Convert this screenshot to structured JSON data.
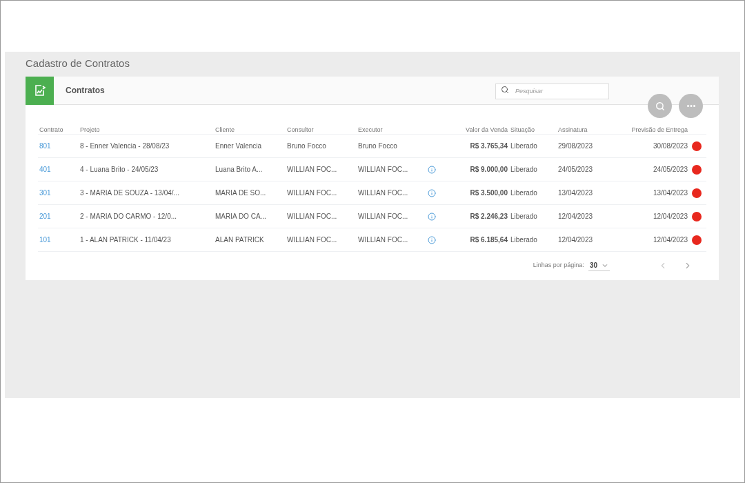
{
  "page_title": "Cadastro de Contratos",
  "card": {
    "title": "Contratos",
    "search": {
      "placeholder": "Pesquisar"
    }
  },
  "table": {
    "columns": [
      "Contrato",
      "Projeto",
      "Cliente",
      "Consultor",
      "Executor",
      "Valor da Venda",
      "Situação",
      "Assinatura",
      "Previsão de Entrega"
    ],
    "rows": [
      {
        "contrato": "801",
        "projeto": "8 - Enner Valencia - 28/08/23",
        "cliente": "Enner Valencia",
        "consultor": "Bruno Focco",
        "executor": "Bruno Focco",
        "info": false,
        "valor": "R$ 3.765,34",
        "situacao": "Liberado",
        "assinatura": "29/08/2023",
        "previsao": "30/08/2023",
        "color": "#e8281e"
      },
      {
        "contrato": "401",
        "projeto": "4 - Luana Brito - 24/05/23",
        "cliente": "Luana Brito A...",
        "consultor": "WILLIAN FOC...",
        "executor": "WILLIAN FOC...",
        "info": true,
        "valor": "R$ 9.000,00",
        "situacao": "Liberado",
        "assinatura": "24/05/2023",
        "previsao": "24/05/2023",
        "color": "#e8281e"
      },
      {
        "contrato": "301",
        "projeto": "3 - MARIA DE SOUZA - 13/04/...",
        "cliente": "MARIA DE SO...",
        "consultor": "WILLIAN FOC...",
        "executor": "WILLIAN FOC...",
        "info": true,
        "valor": "R$ 3.500,00",
        "situacao": "Liberado",
        "assinatura": "13/04/2023",
        "previsao": "13/04/2023",
        "color": "#e8281e"
      },
      {
        "contrato": "201",
        "projeto": "2 - MARIA DO CARMO - 12/0...",
        "cliente": "MARIA DO CA...",
        "consultor": "WILLIAN FOC...",
        "executor": "WILLIAN FOC...",
        "info": true,
        "valor": "R$ 2.246,23",
        "situacao": "Liberado",
        "assinatura": "12/04/2023",
        "previsao": "12/04/2023",
        "color": "#e8281e"
      },
      {
        "contrato": "101",
        "projeto": "1 - ALAN PATRICK - 11/04/23",
        "cliente": "ALAN PATRICK",
        "consultor": "WILLIAN FOC...",
        "executor": "WILLIAN FOC...",
        "info": true,
        "valor": "R$ 6.185,64",
        "situacao": "Liberado",
        "assinatura": "12/04/2023",
        "previsao": "12/04/2023",
        "color": "#e8281e"
      }
    ]
  },
  "pagination": {
    "label": "Linhas por página:",
    "rows_per_page": "30"
  }
}
